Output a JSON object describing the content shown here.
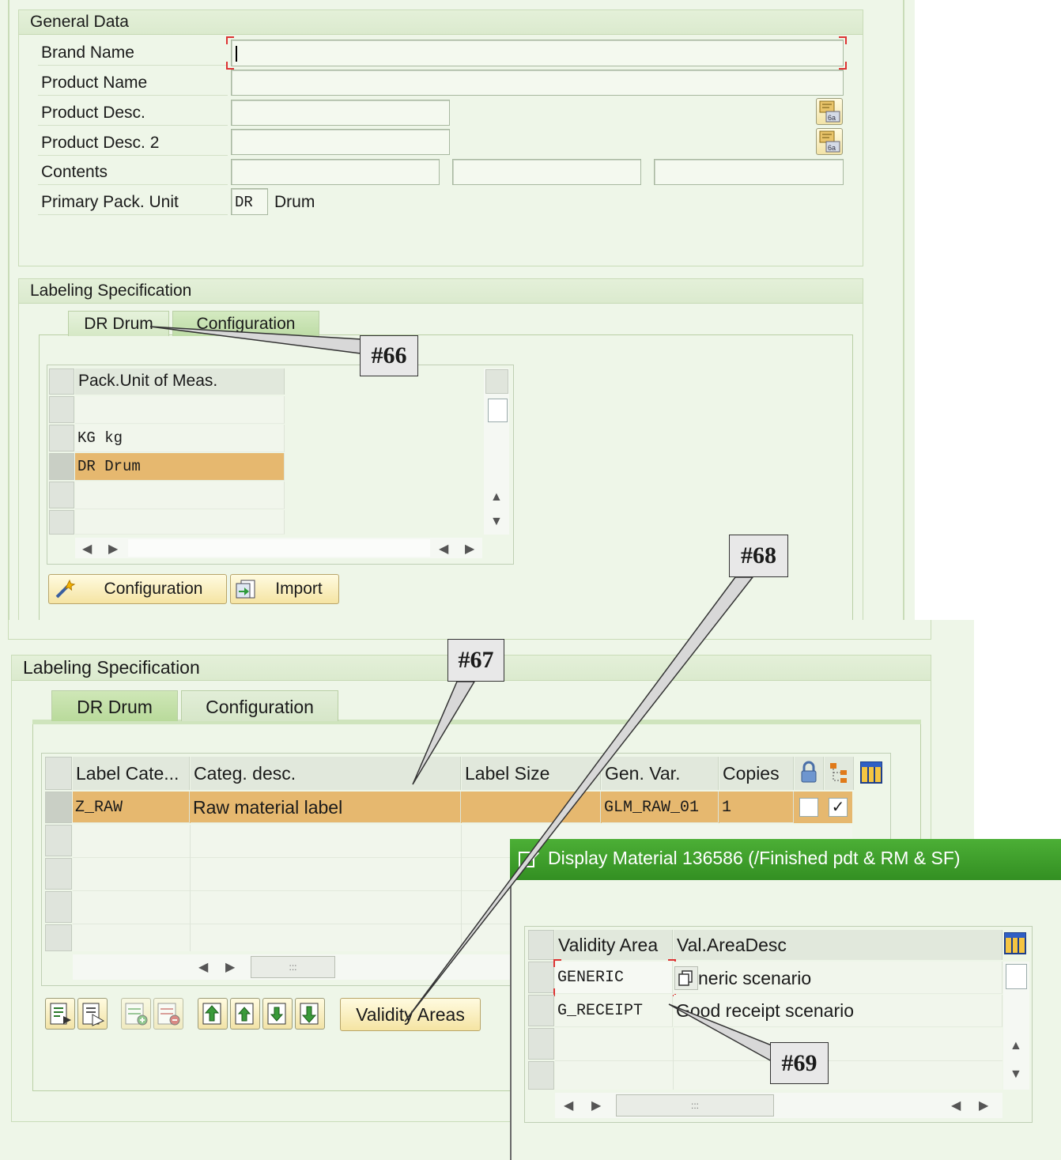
{
  "general": {
    "title": "General Data",
    "fields": {
      "brand_name": "Brand Name",
      "product_name": "Product Name",
      "product_desc": "Product Desc.",
      "product_desc2": "Product Desc. 2",
      "contents": "Contents",
      "primary_pack": "Primary Pack. Unit",
      "pack_code": "DR",
      "pack_text": "Drum"
    }
  },
  "spec1": {
    "title": "Labeling Specification",
    "tab_active": "DR Drum",
    "tab_inactive": "Configuration",
    "table_header": "Pack.Unit of Meas.",
    "rows": [
      "",
      "KG  kg",
      "DR  Drum",
      "",
      ""
    ],
    "btn_config": "Configuration",
    "btn_import": "Import"
  },
  "spec2": {
    "title": "Labeling Specification",
    "tab_active": "DR Drum",
    "tab_inactive": "Configuration",
    "headers": [
      "Label Cate...",
      "Categ. desc.",
      "Label Size",
      "Gen. Var.",
      "Copies"
    ],
    "row1": {
      "cat": "Z_RAW",
      "desc": "Raw material label",
      "size": "",
      "genvar": "GLM_RAW_01",
      "copies": "1"
    },
    "btn_validity": "Validity Areas",
    "handle": ":::"
  },
  "dialog": {
    "title": "Display Material 136586 (/Finished pdt & RM & SF)",
    "headers": [
      "Validity Area",
      "Val.AreaDesc"
    ],
    "rows": [
      {
        "area": "GENERIC",
        "desc": "neric scenario"
      },
      {
        "area": "G_RECEIPT",
        "desc": "Good receipt scenario"
      }
    ],
    "handle": ":::"
  },
  "callouts": {
    "c66": "#66",
    "c67": "#67",
    "c68": "#68",
    "c69": "#69"
  },
  "colors": {
    "panel_bg": "#eef6e8",
    "selected_row": "#e6b86f",
    "dialog_title_bar": "#3e9a2a"
  }
}
